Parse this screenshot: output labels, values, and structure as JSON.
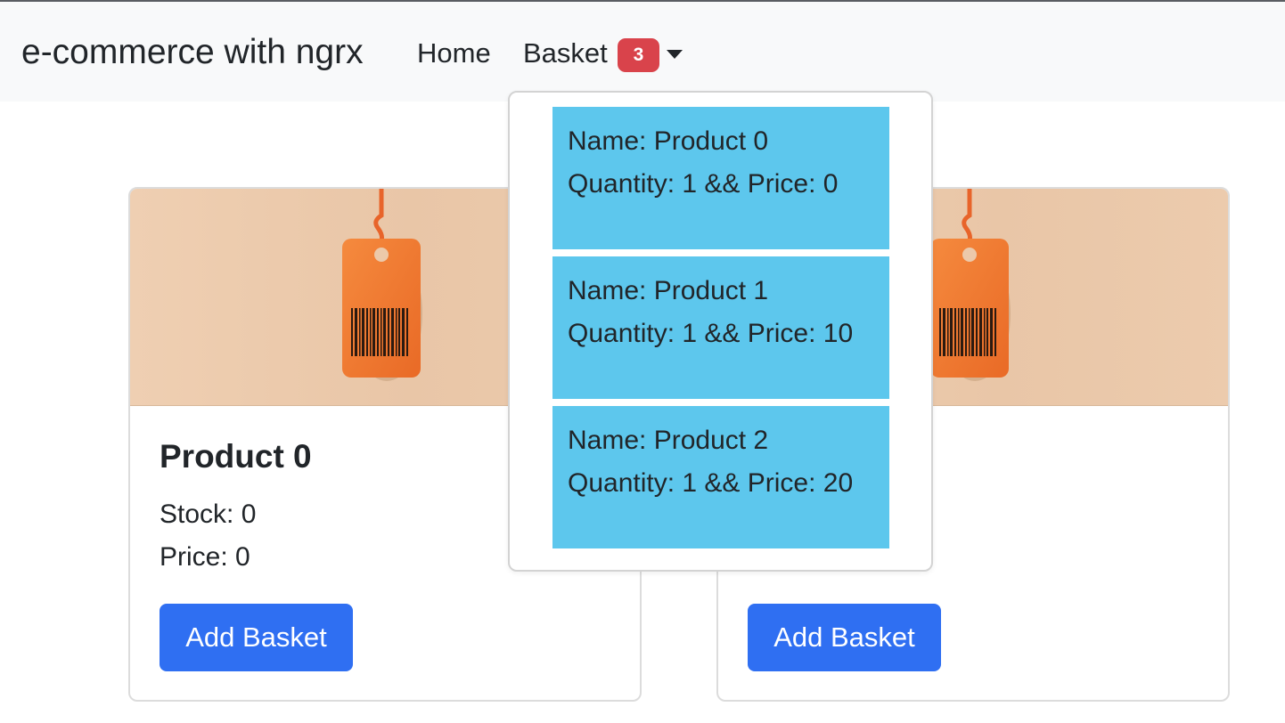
{
  "navbar": {
    "brand": "e-commerce with ngrx",
    "home_label": "Home",
    "basket_label": "Basket",
    "basket_count": "3"
  },
  "products": [
    {
      "title": "Product 0",
      "stock": "Stock: 0",
      "price": "Price: 0",
      "button": "Add Basket"
    },
    {
      "title": "",
      "stock": "",
      "price": "",
      "button": "Add Basket"
    }
  ],
  "basket_dropdown": {
    "items": [
      {
        "name": "Name: Product 0",
        "qty_price": "Quantity: 1 && Price: 0"
      },
      {
        "name": "Name: Product 1",
        "qty_price": "Quantity: 1 && Price: 10"
      },
      {
        "name": "Name: Product 2",
        "qty_price": "Quantity: 1 && Price: 20"
      }
    ]
  },
  "colors": {
    "navbar_bg": "#f8f9fa",
    "badge": "#d9434b",
    "button": "#2f6ff2",
    "basket_item_bg": "#5dc7ed",
    "product_image_bg": "#ecc9aa",
    "tag": "#f07a33"
  },
  "icons": {
    "product_image": "price-tag-icon",
    "caret": "caret-down-icon"
  }
}
